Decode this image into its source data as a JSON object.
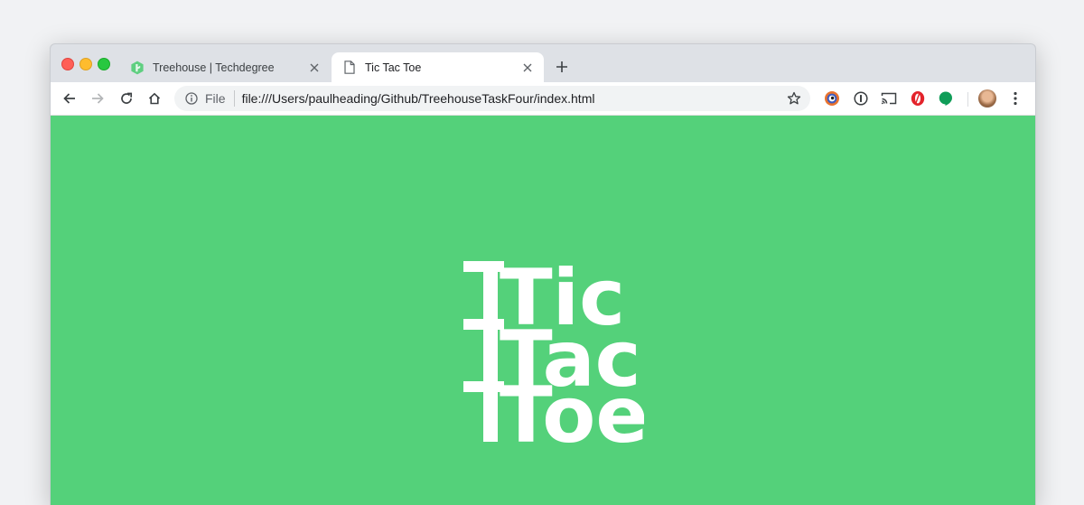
{
  "browser": {
    "tabs": [
      {
        "title": "Treehouse | Techdegree",
        "icon": "treehouse-icon",
        "active": false
      },
      {
        "title": "Tic Tac Toe",
        "icon": "file-icon",
        "active": true
      }
    ],
    "address_bar": {
      "scheme_label": "File",
      "url": "file:///Users/paulheading/Github/TreehouseTaskFour/index.html"
    },
    "toolbar_icons": [
      "back-icon",
      "forward-icon",
      "reload-icon",
      "home-icon",
      "info-icon",
      "star-icon",
      "extension-icon",
      "onepassword-icon",
      "cast-icon",
      "opera-icon",
      "hangouts-icon",
      "profile-avatar",
      "menu-icon"
    ]
  },
  "page": {
    "background_color": "#54d17a",
    "logo_lines": [
      "Tic",
      "Tac",
      "Toe"
    ],
    "logo_color": "#ffffff"
  }
}
